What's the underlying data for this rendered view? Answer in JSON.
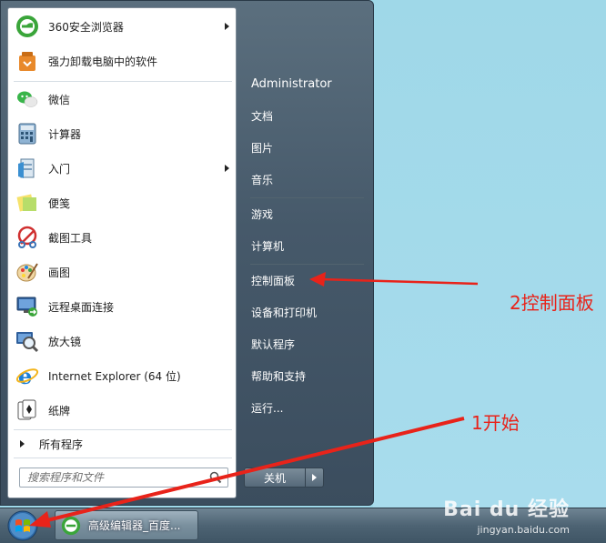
{
  "start_menu": {
    "programs": [
      {
        "label": "360安全浏览器",
        "icon": "browser-360-icon",
        "has_submenu": true
      },
      {
        "label": "强力卸载电脑中的软件",
        "icon": "uninstaller-icon",
        "has_submenu": false
      },
      {
        "label": "微信",
        "icon": "wechat-icon",
        "has_submenu": false
      },
      {
        "label": "计算器",
        "icon": "calculator-icon",
        "has_submenu": false
      },
      {
        "label": "入门",
        "icon": "getting-started-icon",
        "has_submenu": true
      },
      {
        "label": "便笺",
        "icon": "sticky-notes-icon",
        "has_submenu": false
      },
      {
        "label": "截图工具",
        "icon": "snipping-tool-icon",
        "has_submenu": false
      },
      {
        "label": "画图",
        "icon": "paint-icon",
        "has_submenu": false
      },
      {
        "label": "远程桌面连接",
        "icon": "remote-desktop-icon",
        "has_submenu": false
      },
      {
        "label": "放大镜",
        "icon": "magnifier-icon",
        "has_submenu": false
      },
      {
        "label": "Internet Explorer (64 位)",
        "icon": "internet-explorer-icon",
        "has_submenu": false
      },
      {
        "label": "纸牌",
        "icon": "solitaire-icon",
        "has_submenu": false
      }
    ],
    "all_programs": "所有程序",
    "search_placeholder": "搜索程序和文件",
    "right": {
      "user": "Administrator",
      "documents": "文档",
      "pictures": "图片",
      "music": "音乐",
      "games": "游戏",
      "computer": "计算机",
      "control_panel": "控制面板",
      "devices": "设备和打印机",
      "default_programs": "默认程序",
      "help": "帮助和支持",
      "run": "运行..."
    },
    "shutdown": "关机"
  },
  "taskbar": {
    "task_label": "高级编辑器_百度..."
  },
  "annotations": {
    "step2": "2控制面板",
    "step1": "1开始"
  },
  "watermark": {
    "brand": "Bai du 经验",
    "url": "jingyan.baidu.com"
  },
  "colors": {
    "annotation_red": "#e8231a",
    "desktop": "#9fd9ea",
    "menu_dark": "#46596a"
  }
}
